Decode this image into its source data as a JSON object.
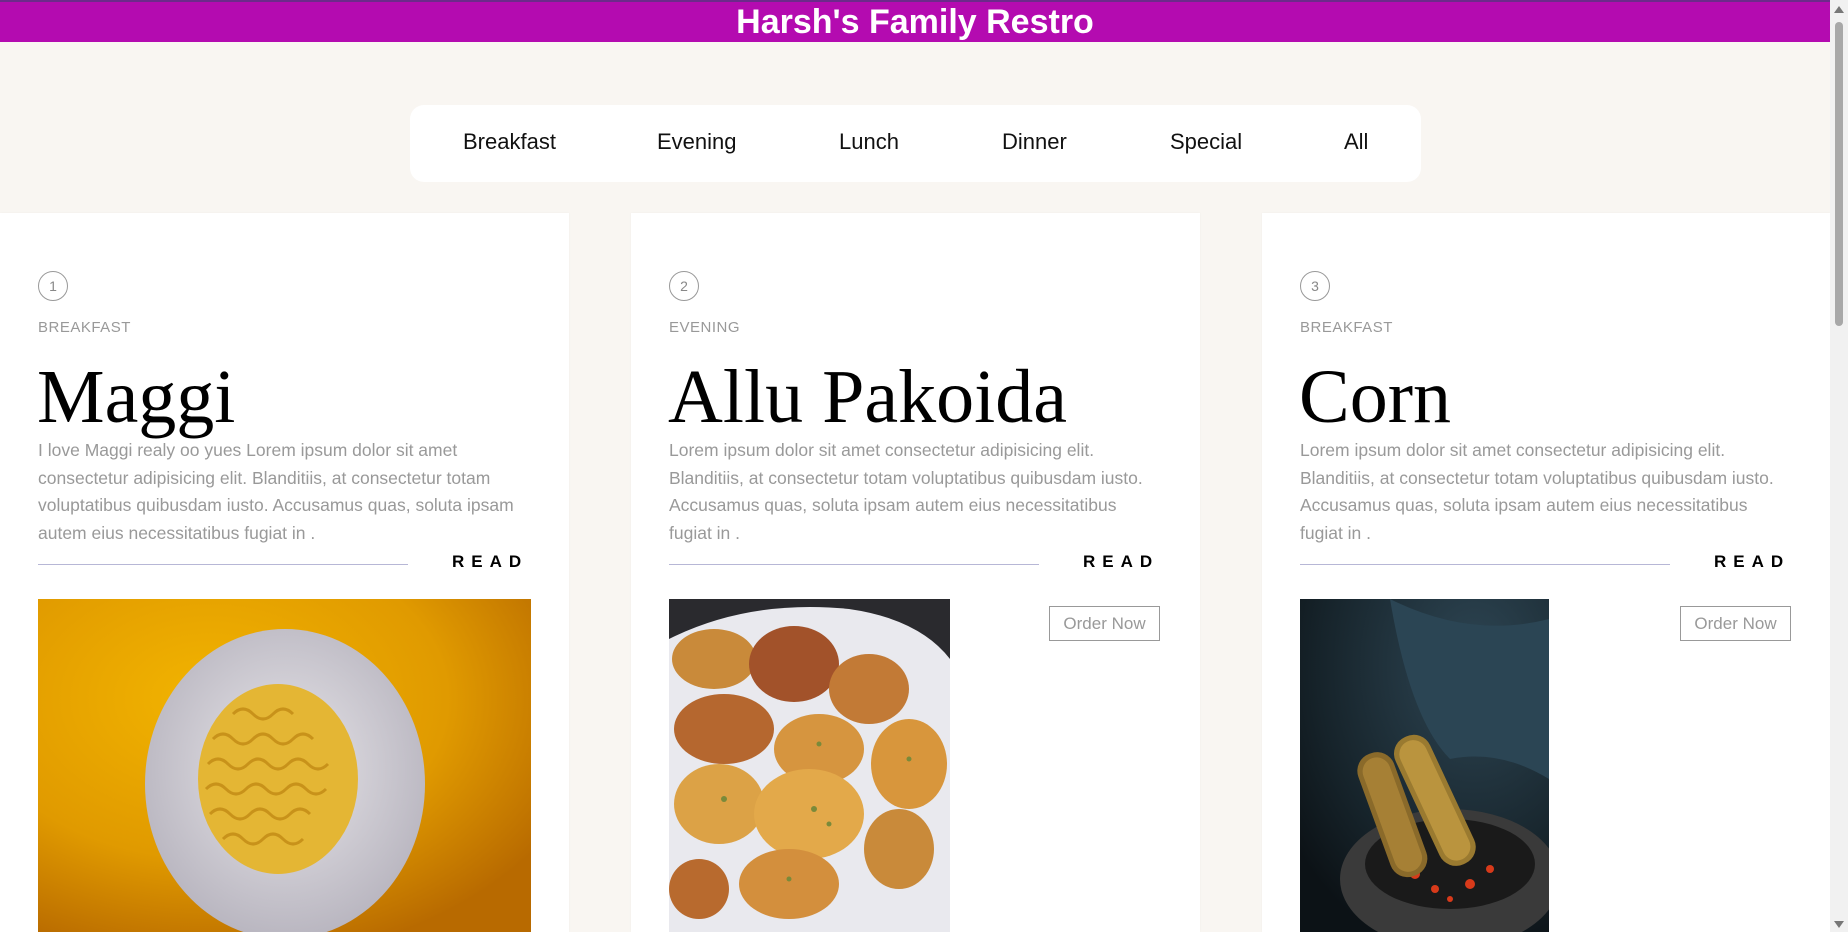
{
  "header": {
    "title": "Harsh's Family Restro",
    "color": "#b40bb0"
  },
  "nav": {
    "items": [
      "Breakfast",
      "Evening",
      "Lunch",
      "Dinner",
      "Special",
      "All"
    ]
  },
  "cards": [
    {
      "number": "1",
      "category": "BREAKFAST",
      "title": "Maggi",
      "description": "I love Maggi realy oo yues Lorem ipsum dolor sit amet consectetur adipisicing elit. Blanditiis, at consectetur totam voluptatibus quibusdam iusto. Accusamus quas, soluta ipsam autem eius necessitatibus fugiat in .",
      "read_label": "READ",
      "image": "maggi-noodles-photo"
    },
    {
      "number": "2",
      "category": "EVENING",
      "title": "Allu Pakoida",
      "description": "Lorem ipsum dolor sit amet consectetur adipisicing elit. Blanditiis, at consectetur totam voluptatibus quibusdam iusto. Accusamus quas, soluta ipsam autem eius necessitatibus fugiat in .",
      "read_label": "READ",
      "order_label": "Order Now",
      "image": "pakoda-photo"
    },
    {
      "number": "3",
      "category": "BREAKFAST",
      "title": "Corn",
      "description": "Lorem ipsum dolor sit amet consectetur adipisicing elit. Blanditiis, at consectetur totam voluptatibus quibusdam iusto. Accusamus quas, soluta ipsam autem eius necessitatibus fugiat in .",
      "read_label": "READ",
      "order_label": "Order Now",
      "image": "roasted-corn-photo"
    }
  ]
}
